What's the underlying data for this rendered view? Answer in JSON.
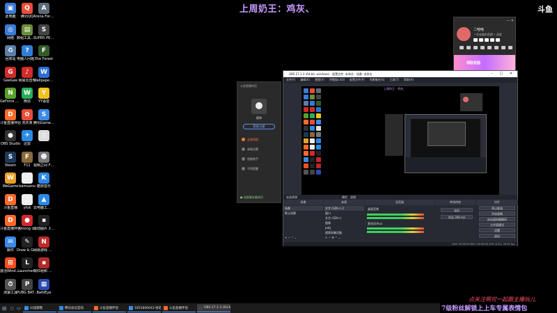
{
  "overlay": {
    "title": "上周奶王：鸡灰、",
    "corner_logo": "斗鱼",
    "bottom_line1": "点关注啊可一起跟主播玩儿",
    "bottom_line2": "7级粉丝解锁上上车专属表情包"
  },
  "desktop": {
    "icons": [
      {
        "label": "此电脑",
        "color": "#3b7bd6",
        "glyph": "▣"
      },
      {
        "label": "腾讯QQ",
        "color": "#e94d3a",
        "glyph": "Q"
      },
      {
        "label": "Arena Fortune...",
        "color": "#5d6b7a",
        "glyph": "A"
      },
      {
        "label": "网络",
        "color": "#3b7bd6",
        "glyph": "◎"
      },
      {
        "label": "数组工具箱 2022",
        "color": "#6b8e3a",
        "glyph": "▤"
      },
      {
        "label": "SUPER PEOPLE CBT",
        "color": "#444",
        "glyph": "S"
      },
      {
        "label": "回收站",
        "color": "#5c7fa8",
        "glyph": "♻"
      },
      {
        "label": "电脑人问题...",
        "color": "#2f7fd6",
        "glyph": "?"
      },
      {
        "label": "The Forest",
        "color": "#355a2a",
        "glyph": "F"
      },
      {
        "label": "GeeGee",
        "color": "#d12a2a",
        "glyph": "G"
      },
      {
        "label": "网易云音乐",
        "color": "#d12a2a",
        "glyph": "♪"
      },
      {
        "label": "Wallpaper Engine:...",
        "color": "#2a6fd1",
        "glyph": "W"
      },
      {
        "label": "GeForce Experience",
        "color": "#5aa02c",
        "glyph": "N"
      },
      {
        "label": "微信",
        "color": "#2bae5b",
        "glyph": "W"
      },
      {
        "label": "YY语音",
        "color": "#f2c21c",
        "glyph": "Y"
      },
      {
        "label": "斗鱼直播伴侣",
        "color": "#ff6a2a",
        "glyph": "D"
      },
      {
        "label": "洗衣液",
        "color": "#e94d3a",
        "glyph": "✿"
      },
      {
        "label": "腾讯GamePro...",
        "color": "#3b8be6",
        "glyph": "S"
      },
      {
        "label": "OBS Studio",
        "color": "#333",
        "glyph": "●"
      },
      {
        "label": "迅雷",
        "color": "#2a8ae6",
        "glyph": "✈"
      },
      {
        "label": "",
        "color": "#dddddd",
        "glyph": "▯"
      },
      {
        "label": "Steam",
        "color": "#1b3a5a",
        "glyph": "S"
      },
      {
        "label": "F11",
        "color": "#8a6a3a",
        "glyph": "F"
      },
      {
        "label": "视频之间 Fear and...",
        "color": "#777",
        "glyph": "☻"
      },
      {
        "label": "WeGame",
        "color": "#e8a02a",
        "glyph": "W"
      },
      {
        "label": "bamuanu",
        "color": "#eee",
        "glyph": "▯"
      },
      {
        "label": "酷狗音乐",
        "color": "#2a8ae6",
        "glyph": "K"
      },
      {
        "label": "斗鱼直播",
        "color": "#ff6a2a",
        "glyph": "D"
      },
      {
        "label": "yfuk",
        "color": "#eee",
        "glyph": "▯"
      },
      {
        "label": "云电脑工具 客户端",
        "color": "#2a8ae6",
        "glyph": "▲"
      },
      {
        "label": "斗鱼直播伴侣",
        "color": "#ff6a2a",
        "glyph": "D"
      },
      {
        "label": "Among Us",
        "color": "#d12a2a",
        "glyph": "●"
      },
      {
        "label": "活动图片 20210...",
        "color": "#222",
        "glyph": "▪"
      },
      {
        "label": "邮件",
        "color": "#3b8be6",
        "glyph": "✉"
      },
      {
        "label": "Draw & Guess",
        "color": "#222",
        "glyph": "✎"
      },
      {
        "label": "网易游戏 启动",
        "color": "#c02a2a",
        "glyph": "N"
      },
      {
        "label": "激活Windows",
        "color": "#f25022",
        "glyph": "⊞"
      },
      {
        "label": "Launcher...",
        "color": "#222",
        "glyph": "L"
      },
      {
        "label": "鲜红组和 用品视频",
        "color": "#b02a2a",
        "glyph": "▪"
      },
      {
        "label": "测速工具",
        "color": "#555",
        "glyph": "⏱"
      },
      {
        "label": "PUBG BATTLEG...",
        "color": "#444",
        "glyph": "P"
      },
      {
        "label": "BattlEye",
        "color": "#2a4ab0",
        "glyph": "▦"
      }
    ]
  },
  "chat_widget": {
    "name": "二哈哈",
    "sub": "一些有趣的直播 • 速度",
    "banner": "领取奖励"
  },
  "side_panel": {
    "header": "斗鱼直播伴侣",
    "username": "昵称",
    "pill": "登录/注册",
    "menu": [
      "云游戏助",
      "录制设置",
      "智能助手",
      "不再提醒"
    ],
    "footer": "● 连接服务器成功"
  },
  "obs": {
    "title": "OBS 27.1.3 (64-bit, windows) - 配置文件: 未命名 - 场景: 未命名",
    "menu": [
      "文件(F)",
      "编辑(E)",
      "视图(V)",
      "停靠窗口(D)",
      "配置文件(P)",
      "场景集合(S)",
      "工具(T)",
      "帮助(H)"
    ],
    "preview_title": "上周奶王：鸡灰、",
    "dock_tabs": [
      "未选择源",
      "属性",
      "滤镜"
    ],
    "docks": {
      "scenes": "场景",
      "sources": "来源",
      "mixer": "混音器",
      "transitions": "转场特效",
      "controls": "控件"
    },
    "scenes": [
      "场景",
      "默认场景"
    ],
    "sources": [
      "文字 (GDI+) 2",
      "窗口",
      "文字 (GDI+)",
      "图像",
      "pdsj",
      "视频采集设备"
    ],
    "mixer": [
      "桌面音频",
      "麦克风/Aux"
    ],
    "transition": [
      "淡出",
      "时长 300 ms"
    ],
    "control_buttons": [
      "停止推流",
      "开始录制",
      "启动虚拟摄像机",
      "工作室模式",
      "设置",
      "退出"
    ],
    "status": "LIVE: 00:00:00  REC: 00:00:00  CPU: 8.3%, 30.00 fps"
  },
  "taskbar": {
    "tasks": [
      {
        "label": "UI成都哦",
        "color": "#3b8be6"
      },
      {
        "label": "腾讯会议是啥",
        "color": "#2a8ae6"
      },
      {
        "label": "斗鱼直播伴侣",
        "color": "#ff6a2a"
      },
      {
        "label": "1855806642-哈哈...",
        "color": "#3b8be6"
      },
      {
        "label": "斗鱼直播伴侣",
        "color": "#ff6a2a"
      },
      {
        "label": "OBS 27.1.3 (64-bit...",
        "color": "#444",
        "active": true
      }
    ]
  }
}
